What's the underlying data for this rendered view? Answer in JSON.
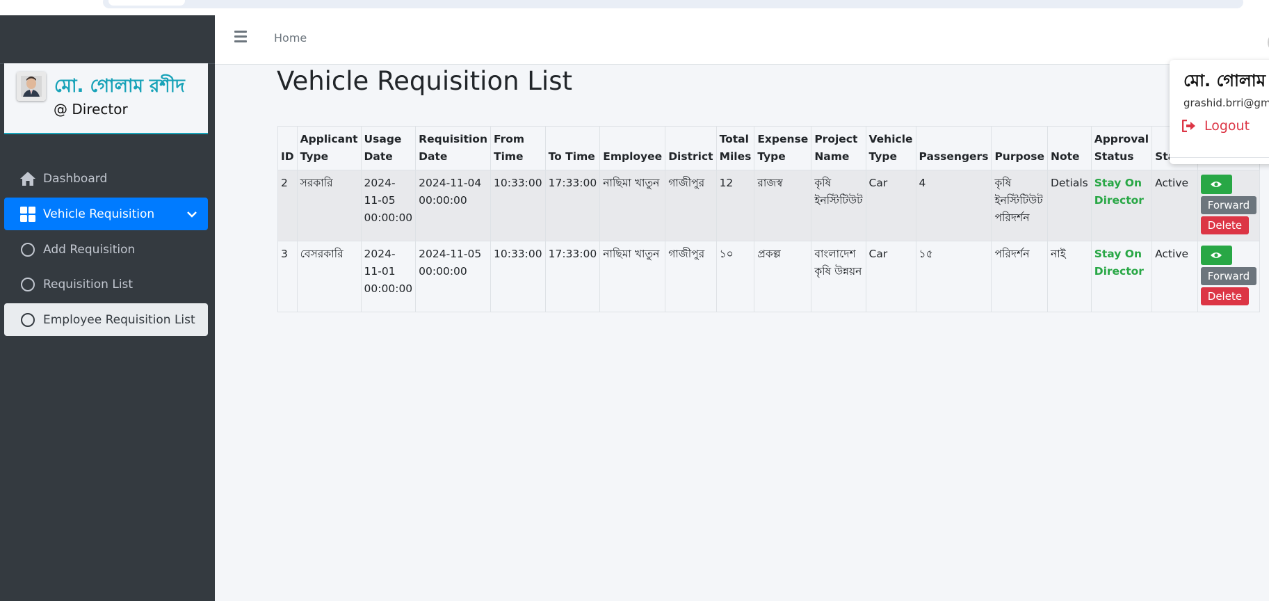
{
  "navbar": {
    "home": "Home"
  },
  "user": {
    "name": "মো. গোলাম রশীদ",
    "role": "@ Director"
  },
  "sidebar": {
    "items": [
      {
        "label": "Dashboard"
      },
      {
        "label": "Vehicle Requisition"
      },
      {
        "label": "Add Requisition"
      },
      {
        "label": "Requisition List"
      },
      {
        "label": "Employee Requisition List"
      }
    ]
  },
  "page": {
    "title": "Vehicle Requisition List"
  },
  "table": {
    "headers": [
      "ID",
      "Applicant Type",
      "Usage Date",
      "Requisition Date",
      "From Time",
      "To Time",
      "Employee",
      "District",
      "Total Miles",
      "Expense Type",
      "Project Name",
      "Vehicle Type",
      "Passengers",
      "Purpose",
      "Note",
      "Approval Status",
      "Status",
      ""
    ],
    "rows": [
      {
        "id": "2",
        "applicant_type": "সরকারি",
        "usage_date": "2024-11-05 00:00:00",
        "requisition_date": "2024-11-04 00:00:00",
        "from_time": "10:33:00",
        "to_time": "17:33:00",
        "employee": "নাছিমা খাতুন",
        "district": "গাজীপুর",
        "total_miles": "12",
        "expense_type": "রাজস্ব",
        "project_name": "কৃষি ইনস্টিটিউট",
        "vehicle_type": "Car",
        "passengers": "4",
        "purpose": "কৃষি ইনস্টিটিউট পরিদর্শন",
        "note": "Detials",
        "approval_status": "Stay On Director",
        "status": "Active"
      },
      {
        "id": "3",
        "applicant_type": "বেসরকারি",
        "usage_date": "2024-11-01 00:00:00",
        "requisition_date": "2024-11-05 00:00:00",
        "from_time": "10:33:00",
        "to_time": "17:33:00",
        "employee": "নাছিমা খাতুন",
        "district": "গাজীপুর",
        "total_miles": "১০",
        "expense_type": "প্রকল্প",
        "project_name": "বাংলাদেশ কৃষি উন্নয়ন",
        "vehicle_type": "Car",
        "passengers": "১৫",
        "purpose": "পরিদর্শন",
        "note": "নাই",
        "approval_status": "Stay On Director",
        "status": "Active"
      }
    ],
    "actions": {
      "forward": "Forward",
      "delete": "Delete"
    }
  },
  "dropdown": {
    "name": "মো. গোলাম র",
    "email": "grashid.brri@gmai",
    "logout": "Logout"
  },
  "colors": {
    "sidebar": "#343a40",
    "active": "#007bff",
    "approval": "#28a745",
    "danger": "#dc3545",
    "secondary": "#6c757d",
    "brand": "#17a2b8"
  },
  "icons": {
    "dashboard": "home-icon",
    "vehicle": "grid-icon",
    "sub": "circle-icon",
    "view": "eye-icon",
    "logout": "sign-out-icon",
    "menu": "hamburger-icon"
  }
}
